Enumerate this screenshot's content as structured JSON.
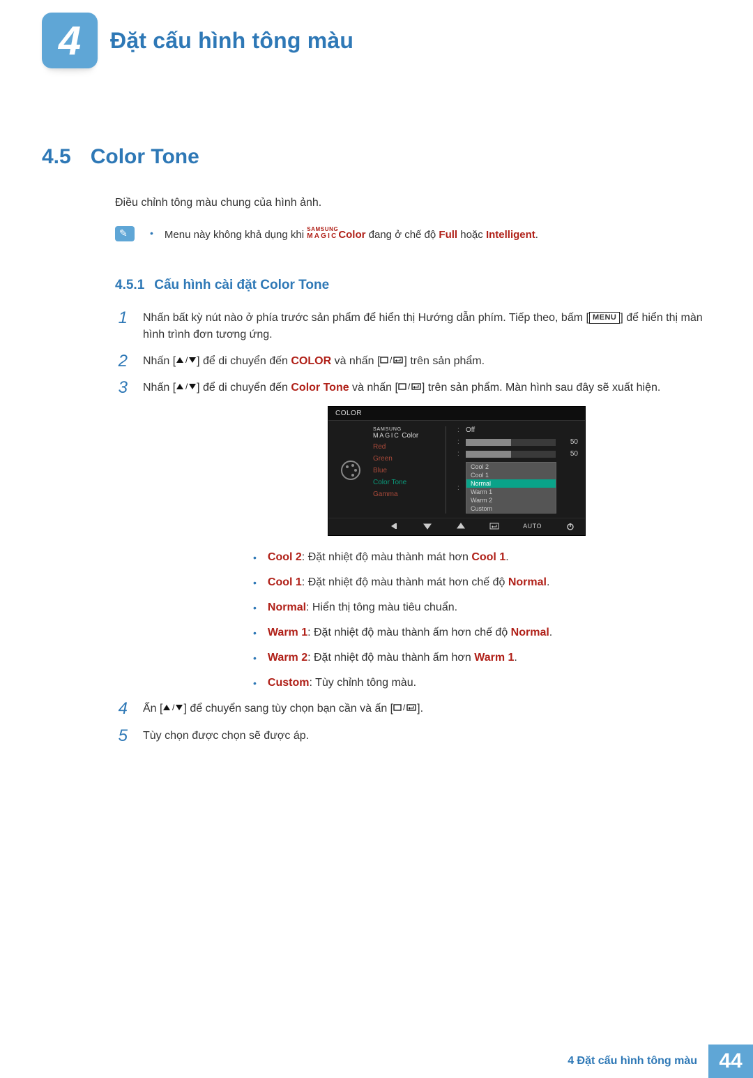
{
  "chapter": {
    "number": "4",
    "title": "Đặt cấu hình tông màu"
  },
  "section": {
    "number": "4.5",
    "title": "Color Tone"
  },
  "intro": "Điều chỉnh tông màu chung của hình ảnh.",
  "note": {
    "prefix": "Menu này không khả dụng khi ",
    "brand_top": "SAMSUNG",
    "brand_bot": "MAGIC",
    "brand_suffix": "Color",
    "mid": " đang ở chế độ ",
    "mode1": "Full",
    "mid2": " hoặc ",
    "mode2": "Intelligent",
    "suffix": "."
  },
  "subsection": {
    "number": "4.5.1",
    "title": "Cấu hình cài đặt Color Tone"
  },
  "steps": {
    "s1": {
      "num": "1",
      "a": "Nhấn bất kỳ nút nào ở phía trước sản phẩm để hiển thị Hướng dẫn phím. Tiếp theo, bấm [",
      "menu": "MENU",
      "b": "] để hiển thị màn hình trình đơn tương ứng."
    },
    "s2": {
      "num": "2",
      "a": "Nhấn [",
      "b": "] để di chuyển đến ",
      "kw": "COLOR",
      "c": " và nhấn [",
      "d": "] trên sản phẩm."
    },
    "s3": {
      "num": "3",
      "a": "Nhấn [",
      "b": "] để di chuyển đến ",
      "kw": "Color Tone",
      "c": " và nhấn [",
      "d": "] trên sản phẩm. Màn hình sau đây sẽ xuất hiện."
    },
    "s4": {
      "num": "4",
      "a": "Ấn [",
      "b": "] để chuyển sang tùy chọn bạn cần và ấn [",
      "c": "]."
    },
    "s5": {
      "num": "5",
      "text": "Tùy chọn được chọn sẽ được áp."
    }
  },
  "osd": {
    "title": "COLOR",
    "magic_top": "SAMSUNG",
    "magic_bot": "MAGIC",
    "magic_suffix": "Color",
    "labels": {
      "red": "Red",
      "green": "Green",
      "blue": "Blue",
      "colortone": "Color Tone",
      "gamma": "Gamma"
    },
    "off": "Off",
    "slider1": "50",
    "slider2": "50",
    "dropdown": {
      "cool2": "Cool 2",
      "cool1": "Cool 1",
      "normal": "Normal",
      "warm1": "Warm 1",
      "warm2": "Warm 2",
      "custom": "Custom"
    },
    "auto": "AUTO"
  },
  "tones": {
    "cool2": {
      "name": "Cool 2",
      "mid": ": Đặt nhiệt độ màu thành mát hơn ",
      "ref": "Cool 1",
      "suffix": "."
    },
    "cool1": {
      "name": "Cool 1",
      "mid": ": Đặt nhiệt độ màu thành mát hơn chế độ ",
      "ref": "Normal",
      "suffix": "."
    },
    "normal": {
      "name": "Normal",
      "mid": ": Hiển thị tông màu tiêu chuẩn."
    },
    "warm1": {
      "name": "Warm 1",
      "mid": ": Đặt nhiệt độ màu thành ấm hơn chế độ ",
      "ref": "Normal",
      "suffix": "."
    },
    "warm2": {
      "name": "Warm 2",
      "mid": ": Đặt nhiệt độ màu thành ấm hơn ",
      "ref": "Warm 1",
      "suffix": "."
    },
    "custom": {
      "name": "Custom",
      "mid": ": Tùy chỉnh tông màu."
    }
  },
  "footer": {
    "label": "4 Đặt cấu hình tông màu",
    "page": "44"
  }
}
